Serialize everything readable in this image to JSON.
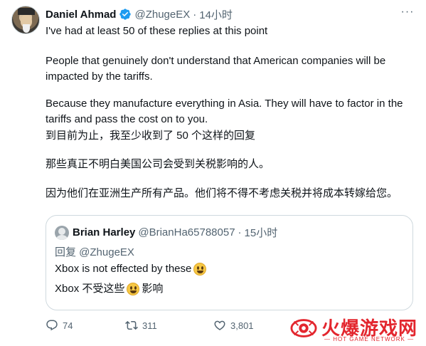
{
  "author": {
    "name": "Daniel Ahmad",
    "handle": "@ZhugeEX",
    "separator": "·",
    "time": "14小时"
  },
  "more_label": "···",
  "body": {
    "line1": "I've had at least 50 of these replies at this point",
    "line2": "People that genuinely don't understand that American companies will be impacted by the tariffs.",
    "line3": "Because they manufacture everything in Asia. They will have to factor in the tariffs and pass the cost on to you.",
    "zh1": "到目前为止，我至少收到了 50 个这样的回复",
    "zh2": "那些真正不明白美国公司会受到关税影响的人。",
    "zh3": "因为他们在亚洲生产所有产品。他们将不得不考虑关税并将成本转嫁给您。"
  },
  "quote": {
    "name": "Brian Harley",
    "handle": "@BrianHa65788057",
    "separator": "·",
    "time": "15小时",
    "reply_to": "回复 @ZhugeEX",
    "text_en": "Xbox is not effected by these",
    "text_zh_before": "Xbox 不受这些",
    "text_zh_after": "影响"
  },
  "actions": {
    "replies": "74",
    "retweets": "311",
    "likes": "3,801"
  },
  "watermark": {
    "title": "火爆游戏网",
    "subtitle": "— HOT GAME NETWORK —"
  },
  "colors": {
    "text": "#0f1419",
    "muted": "#536471",
    "verified": "#1d9bf0",
    "border": "#cfd9de",
    "watermark": "#e3262e"
  }
}
